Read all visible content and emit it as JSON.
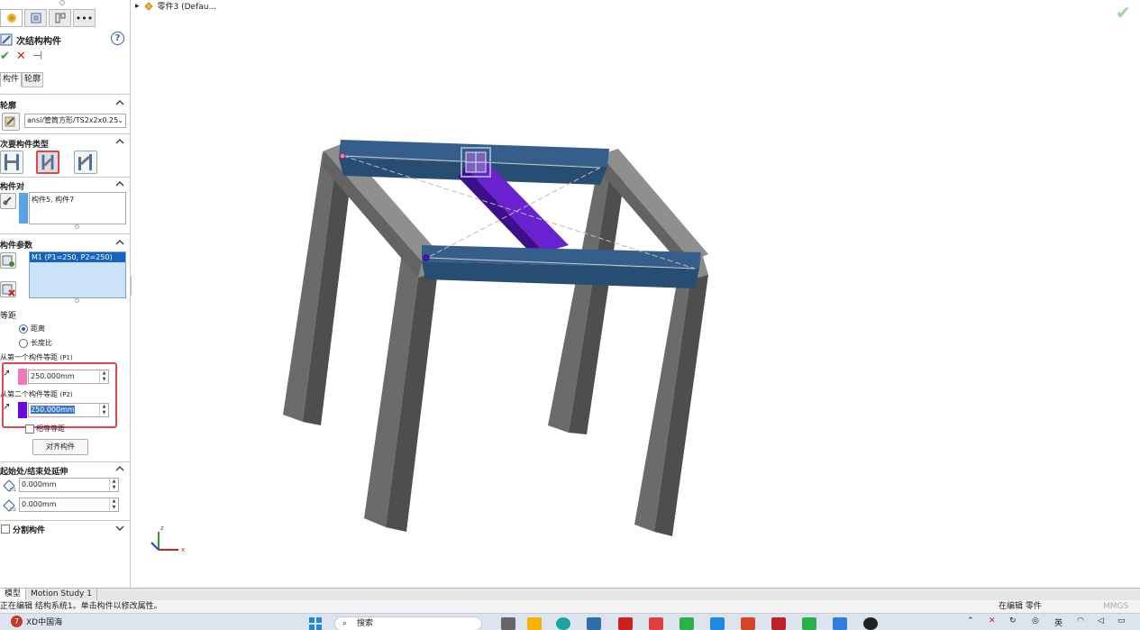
{
  "panel": {
    "title": "次结构构件",
    "help": "?",
    "subtabs": [
      "构件",
      "轮廓"
    ],
    "profile": {
      "section": "轮廓",
      "value": "ansi/管筒方形/TS2x2x0.25"
    },
    "member_type": {
      "section": "次要构件类型"
    },
    "member_pair": {
      "section": "构件对",
      "value": "构件5, 构件7"
    },
    "member_params": {
      "section": "构件参数",
      "selected_item": "M1 (P1=250, P2=250)"
    },
    "offset": {
      "section": "等距",
      "options": [
        "距离",
        "长度比"
      ],
      "selected": 0,
      "p1_label": "从第一个构件等距",
      "p1_tag": "(P1)",
      "p1_value": "250.000mm",
      "p2_label": "从第二个构件等距",
      "p2_tag": "(P2)",
      "p2_value": "250.000mm",
      "equal_label": "相等等距",
      "align_button": "对齐构件"
    },
    "extend": {
      "section": "起始处/结束处延伸",
      "d1_value": "0.000mm",
      "d2_value": "0.000mm"
    },
    "split": {
      "label": "分割构件"
    }
  },
  "viewport": {
    "tree_item": "零件3 (Defau..."
  },
  "bottom_tabs": [
    "模型",
    "Motion Study 1"
  ],
  "status": {
    "left": "正在编辑 结构系统1。单击构件以修改属性。",
    "middle": "在编辑 零件",
    "right": "MMGS"
  },
  "taskbar": {
    "weather_badge": "7",
    "weather_text": "XD中国海",
    "search_placeholder": "搜索",
    "tray_lang": "英"
  },
  "colors": {
    "p1_swatch": "#f07ab8",
    "p2_swatch": "#6a0bd8",
    "highlight_box": "#e2474e",
    "beam_blue": "#274d72",
    "leg_gray": "#6b6b6b",
    "secondary_purple": "#5a17b8"
  }
}
